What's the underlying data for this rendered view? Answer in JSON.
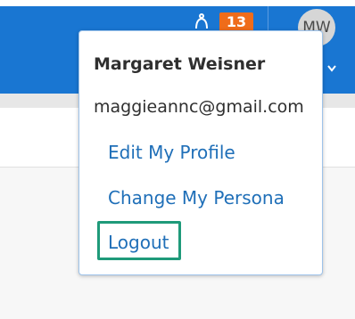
{
  "header": {
    "notification_count": "13",
    "avatar_initials": "MW",
    "icons": {
      "bell": "bell-icon",
      "caret": "chevron-down-icon"
    },
    "colors": {
      "header_blue": "#1976d2",
      "badge_orange": "#ef6c1a",
      "link_blue": "#1f6fb8",
      "highlight_green": "#1f9a7a"
    }
  },
  "user_menu": {
    "name": "Margaret Weisner",
    "email": "maggieannc@gmail.com",
    "items": [
      {
        "label": "Edit My Profile"
      },
      {
        "label": "Change My Persona"
      },
      {
        "label": "Logout"
      }
    ]
  }
}
